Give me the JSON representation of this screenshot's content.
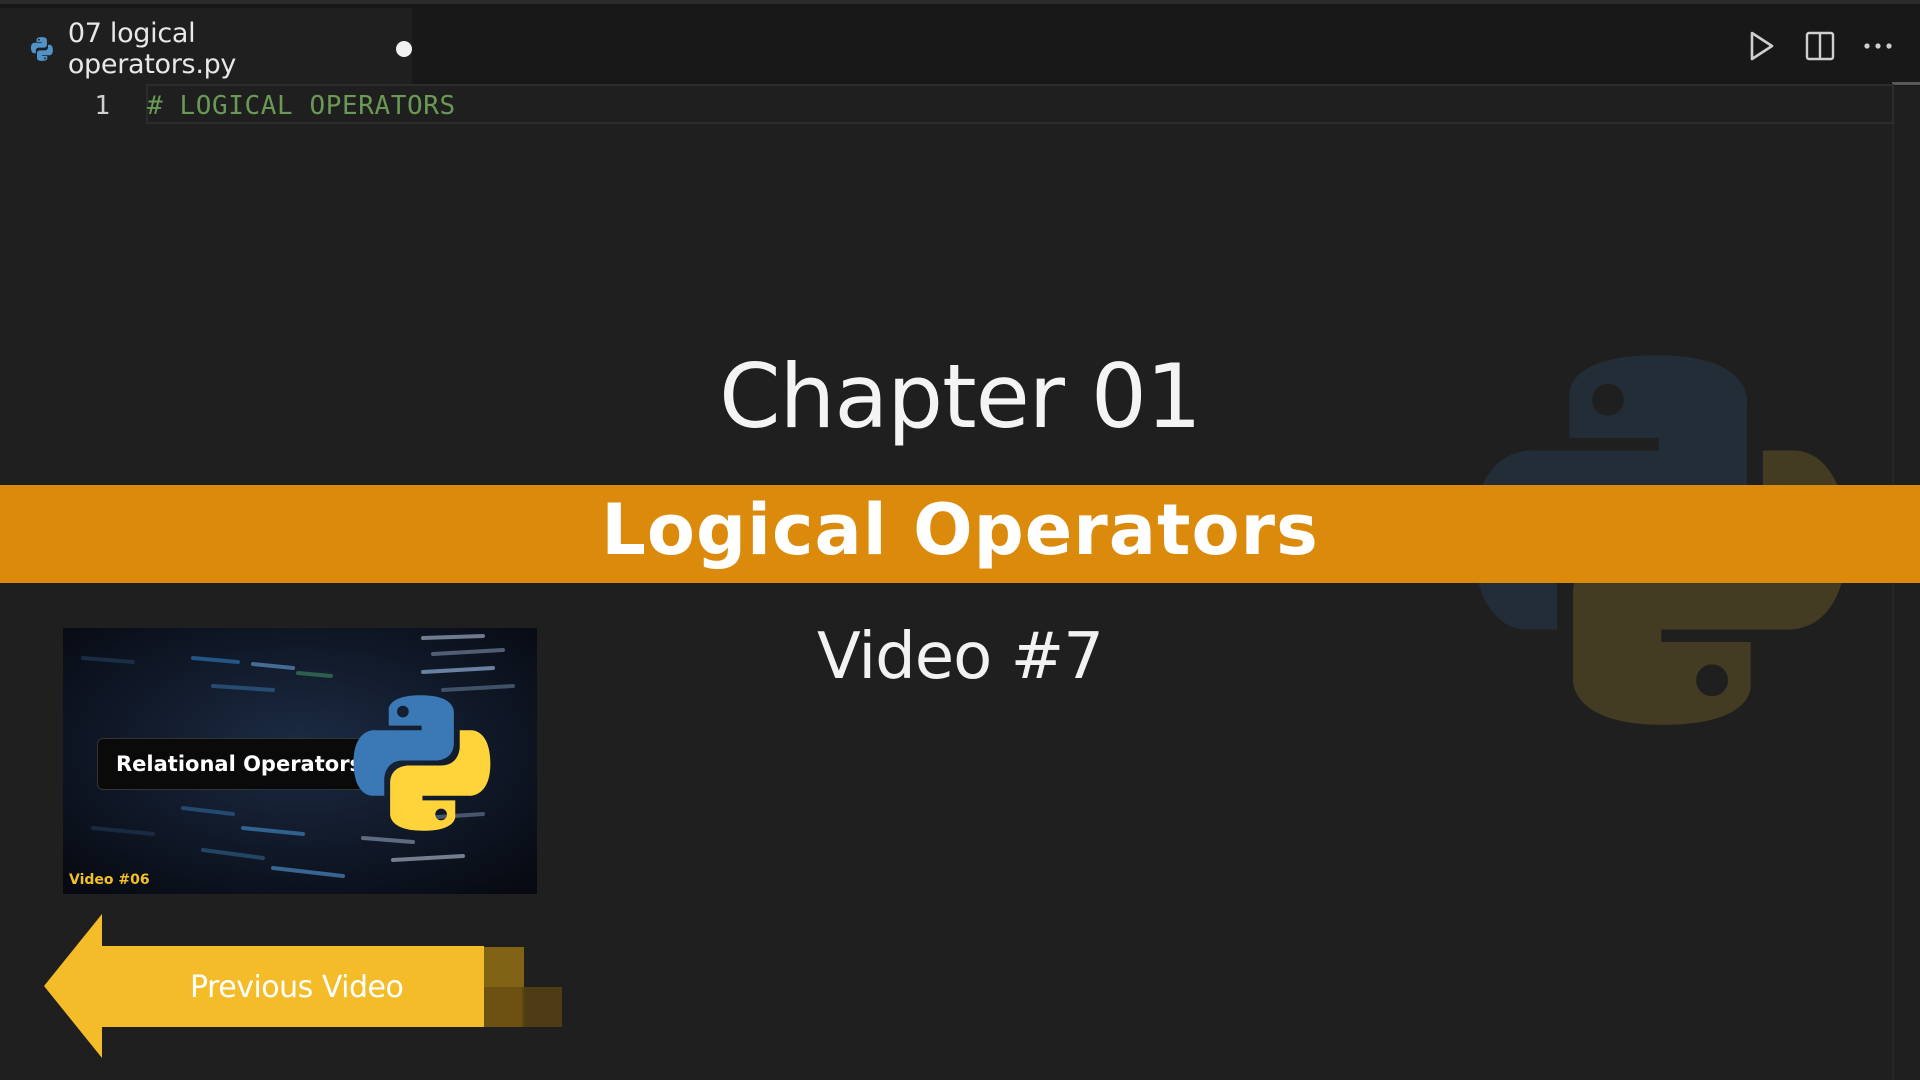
{
  "editor": {
    "tab": {
      "label": "07 logical operators.py",
      "icon": "python-file-icon"
    },
    "actions": [
      "run-icon",
      "split-editor-icon",
      "more-actions-icon"
    ],
    "lines": [
      {
        "number": "1",
        "text": "# LOGICAL OPERATORS"
      }
    ]
  },
  "overlay": {
    "chapter": "Chapter 01",
    "title": "Logical Operators",
    "video": "Video #7",
    "banner_color": "#db8a0c"
  },
  "previous": {
    "thumbnail_title": "Relational Operators",
    "thumbnail_video": "Video #06",
    "button_label": "Previous Video",
    "button_color": "#f3bc28"
  }
}
